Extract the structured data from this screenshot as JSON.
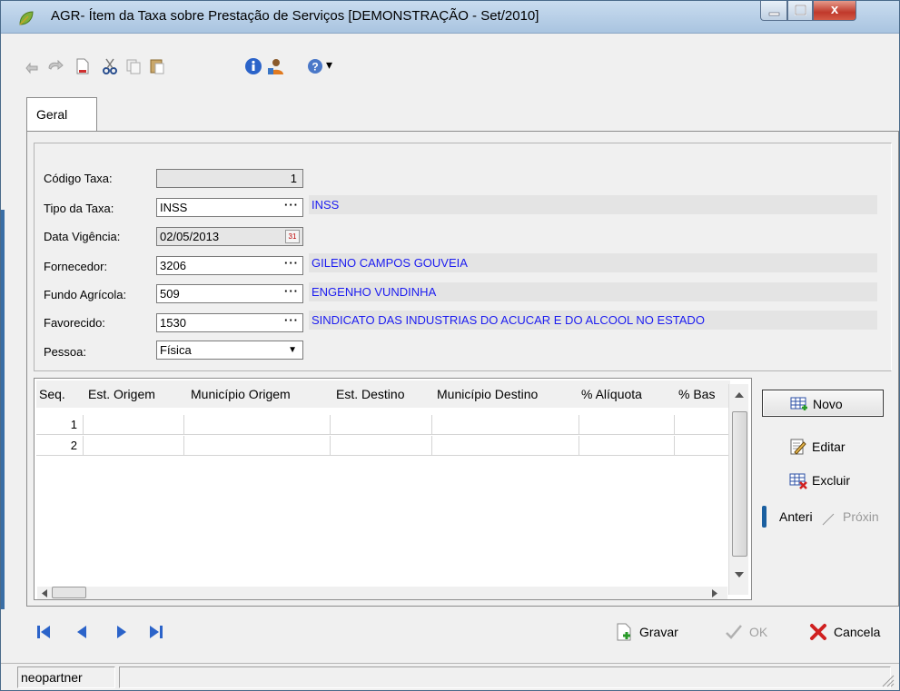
{
  "window": {
    "title": "AGR- Ítem da Taxa sobre Prestação de Serviços [DEMONSTRAÇÃO - Set/2010]",
    "close_glyph": "x"
  },
  "toolbar": {
    "icons": [
      "undo-icon",
      "redo-icon",
      "new-document-icon",
      "cut-icon",
      "copy-icon",
      "paste-icon",
      "info-icon",
      "user-icon",
      "help-icon",
      "dropdown-arrow-icon"
    ],
    "dropdown_glyph": "▾"
  },
  "tabs": [
    {
      "label": "Geral"
    }
  ],
  "form": {
    "codigo_taxa": {
      "label": "Código Taxa:",
      "value": "1"
    },
    "tipo_taxa": {
      "label": "Tipo da Taxa:",
      "value": "INSS",
      "description": "INSS"
    },
    "data_vigencia": {
      "label": "Data Vigência:",
      "value": "02/05/2013"
    },
    "fornecedor": {
      "label": "Fornecedor:",
      "value": "3206",
      "description": "GILENO CAMPOS GOUVEIA"
    },
    "fundo_agricola": {
      "label": "Fundo Agrícola:",
      "value": "509",
      "description": "ENGENHO VUNDINHA"
    },
    "favorecido": {
      "label": "Favorecido:",
      "value": "1530",
      "description": "SINDICATO DAS INDUSTRIAS DO ACUCAR E DO ALCOOL NO ESTADO"
    },
    "pessoa": {
      "label": "Pessoa:",
      "value": "Física"
    },
    "lookup_glyph": "···",
    "calendar_glyph": "31",
    "select_glyph": "▼"
  },
  "grid": {
    "columns": [
      "Seq.",
      "Est. Origem",
      "Município Origem",
      "Est. Destino",
      "Município Destino",
      "% Alíquota",
      "% Bas"
    ],
    "rows": [
      {
        "seq": "1"
      },
      {
        "seq": "2"
      }
    ]
  },
  "side_buttons": {
    "novo": "Novo",
    "editar": "Editar",
    "excluir": "Excluir",
    "anterior": "Anteri",
    "proximo": "Próxin"
  },
  "actions": {
    "gravar": "Gravar",
    "ok": "OK",
    "cancela": "Cancela"
  },
  "status": {
    "user": "neopartner"
  },
  "colors": {
    "description_text": "#1c1cf0",
    "title_bar": "#b9d1ea",
    "close_button": "#c0392b"
  }
}
